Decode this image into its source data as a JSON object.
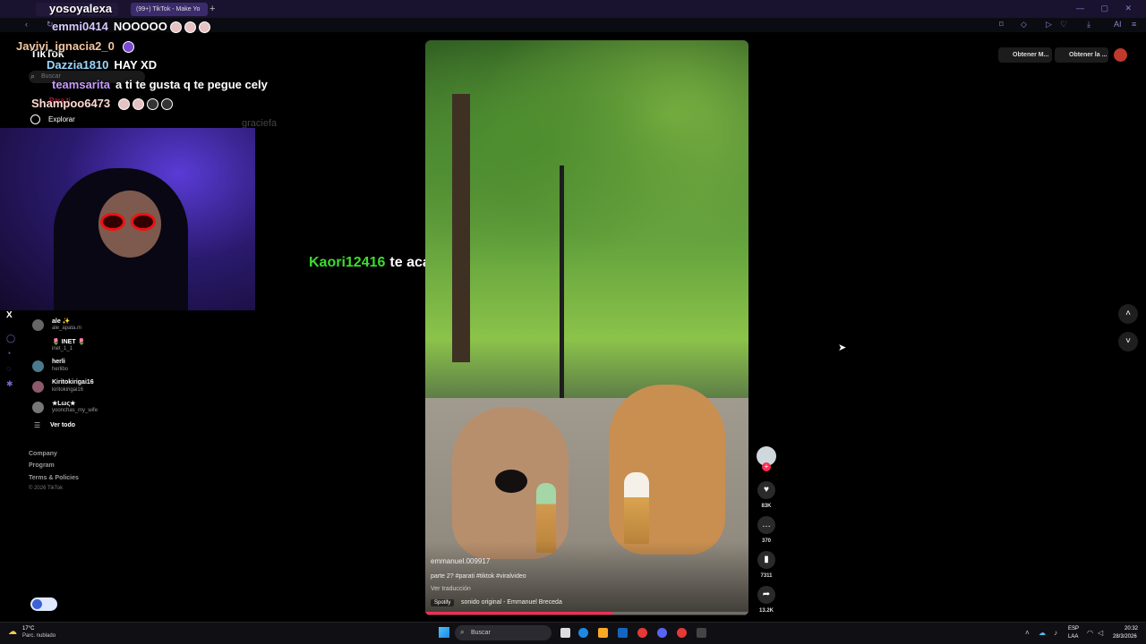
{
  "browser": {
    "tabs": [
      {
        "label": "yosoyalexa"
      },
      {
        "label": "(99+) TikTok - Make Yo"
      }
    ],
    "new_tab": "+"
  },
  "stream": {
    "title": "yosoyalexa",
    "chat": [
      {
        "user": "emmi0414",
        "user_color": "#d7c9ff",
        "message": "NOOOOO",
        "emotes": 3
      },
      {
        "user": "Javivi_ignacia2_0",
        "user_color": "#f2c6a0",
        "message": "",
        "emotes": 1
      },
      {
        "user": "Dazzia1810",
        "user_color": "#9ad7ff",
        "message": "HAY XD",
        "emotes": 0
      },
      {
        "user": "teamsarita",
        "user_color": "#c79bff",
        "message": "a ti te gusta q te pegue cely",
        "emotes": 0
      },
      {
        "user": "Shampoo6473",
        "user_color": "#ffd9d0",
        "message": "",
        "emotes": 4
      }
    ],
    "alert": {
      "user": "Kaori12416",
      "message": "te acaba de seguir!"
    }
  },
  "tiktok": {
    "logo": "TikTok",
    "search_placeholder": "Buscar",
    "nav": {
      "for_you": "Para ti",
      "explore": "Explorar"
    },
    "ghost_name": "graciefa",
    "following": [
      {
        "name": "ale ✨",
        "handle": "ale_apata.m"
      },
      {
        "name": "🌷 INET 🌷",
        "handle": "inet_1_1"
      },
      {
        "name": "herli",
        "handle": "herlibo"
      },
      {
        "name": "Kiritokirigai16",
        "handle": "kiritokirigai16"
      },
      {
        "name": "★Lως★",
        "handle": "yoonchas_my_wife"
      }
    ],
    "see_all": "Ver todo",
    "footer": [
      "Company",
      "Program",
      "Terms & Policies"
    ],
    "copyright": "© 2026 TikTok",
    "top_buttons": [
      "Obtener M...",
      "Obtener la ..."
    ],
    "video": {
      "author": "emmanuel.009917",
      "caption": "parte 2? #parati #tiktok #viralvideo",
      "translate": "Ver traducción",
      "music_tag": "Spotify",
      "sound": "sonido original - Emmanuel Breceda",
      "progress": 0.58
    },
    "actions": {
      "likes": "83K",
      "comments": "370",
      "saves": "7311",
      "shares": "13.2K"
    }
  },
  "taskbar": {
    "weather_temp": "17°C",
    "weather_desc": "Parc. nublado",
    "search": "Buscar",
    "lang1": "ESP",
    "lang2": "LAA",
    "time": "20:32",
    "date": "28/3/2026"
  }
}
